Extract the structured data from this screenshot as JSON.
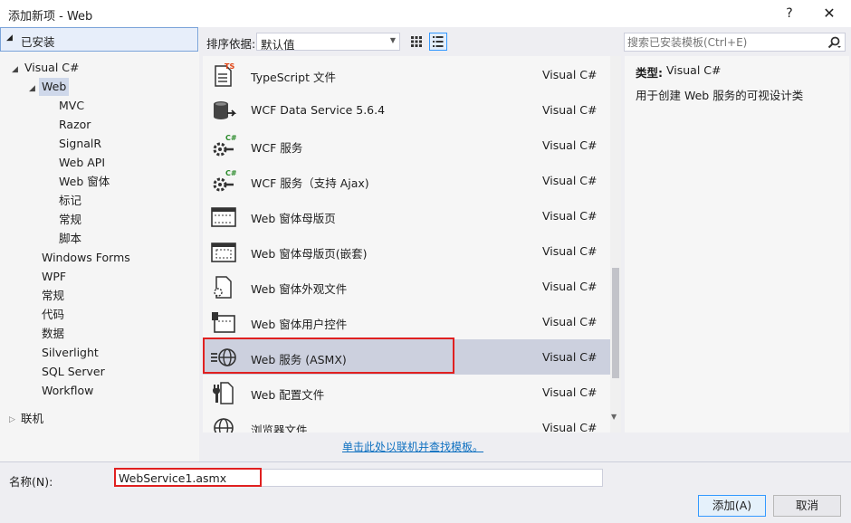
{
  "window": {
    "title": "添加新项 - Web",
    "help": "?",
    "close": "✕"
  },
  "tree": {
    "installed": "已安装",
    "visual_csharp": "Visual C#",
    "web": "Web",
    "web_children": [
      "MVC",
      "Razor",
      "SignalR",
      "Web API",
      "Web 窗体",
      "标记",
      "常规",
      "脚本"
    ],
    "csharp_children": [
      "Windows Forms",
      "WPF",
      "常规",
      "代码",
      "数据",
      "Silverlight",
      "SQL Server",
      "Workflow"
    ],
    "online": "联机"
  },
  "toolbar": {
    "sort_label": "排序依据:",
    "sort_value": "默认值"
  },
  "search": {
    "placeholder": "搜索已安装模板(Ctrl+E)"
  },
  "templates": [
    {
      "name": "TypeScript 文件",
      "type": "Visual C#",
      "icon": "typescript-file-icon"
    },
    {
      "name": "WCF Data Service 5.6.4",
      "type": "Visual C#",
      "icon": "data-service-icon"
    },
    {
      "name": "WCF 服务",
      "type": "Visual C#",
      "icon": "wcf-service-icon"
    },
    {
      "name": "WCF 服务（支持 Ajax)",
      "type": "Visual C#",
      "icon": "wcf-ajax-service-icon"
    },
    {
      "name": "Web 窗体母版页",
      "type": "Visual C#",
      "icon": "master-page-icon"
    },
    {
      "name": "Web 窗体母版页(嵌套)",
      "type": "Visual C#",
      "icon": "nested-master-page-icon"
    },
    {
      "name": "Web 窗体外观文件",
      "type": "Visual C#",
      "icon": "skin-file-icon"
    },
    {
      "name": "Web 窗体用户控件",
      "type": "Visual C#",
      "icon": "user-control-icon"
    },
    {
      "name": "Web 服务 (ASMX)",
      "type": "Visual C#",
      "icon": "web-service-icon"
    },
    {
      "name": "Web 配置文件",
      "type": "Visual C#",
      "icon": "web-config-icon"
    },
    {
      "name": "浏览器文件",
      "type": "Visual C#",
      "icon": "browser-file-icon"
    }
  ],
  "details": {
    "type_label": "类型:",
    "type_value": "Visual C#",
    "description": "用于创建 Web 服务的可视设计类"
  },
  "online_link": "单击此处以联机并查找模板。",
  "name_field": {
    "label": "名称(N):",
    "value": "WebService1.asmx"
  },
  "buttons": {
    "add": "添加(A)",
    "cancel": "取消"
  },
  "colors": {
    "highlight": "#e02020",
    "selected_row": "#ccd0de",
    "link": "#0e70c0"
  }
}
